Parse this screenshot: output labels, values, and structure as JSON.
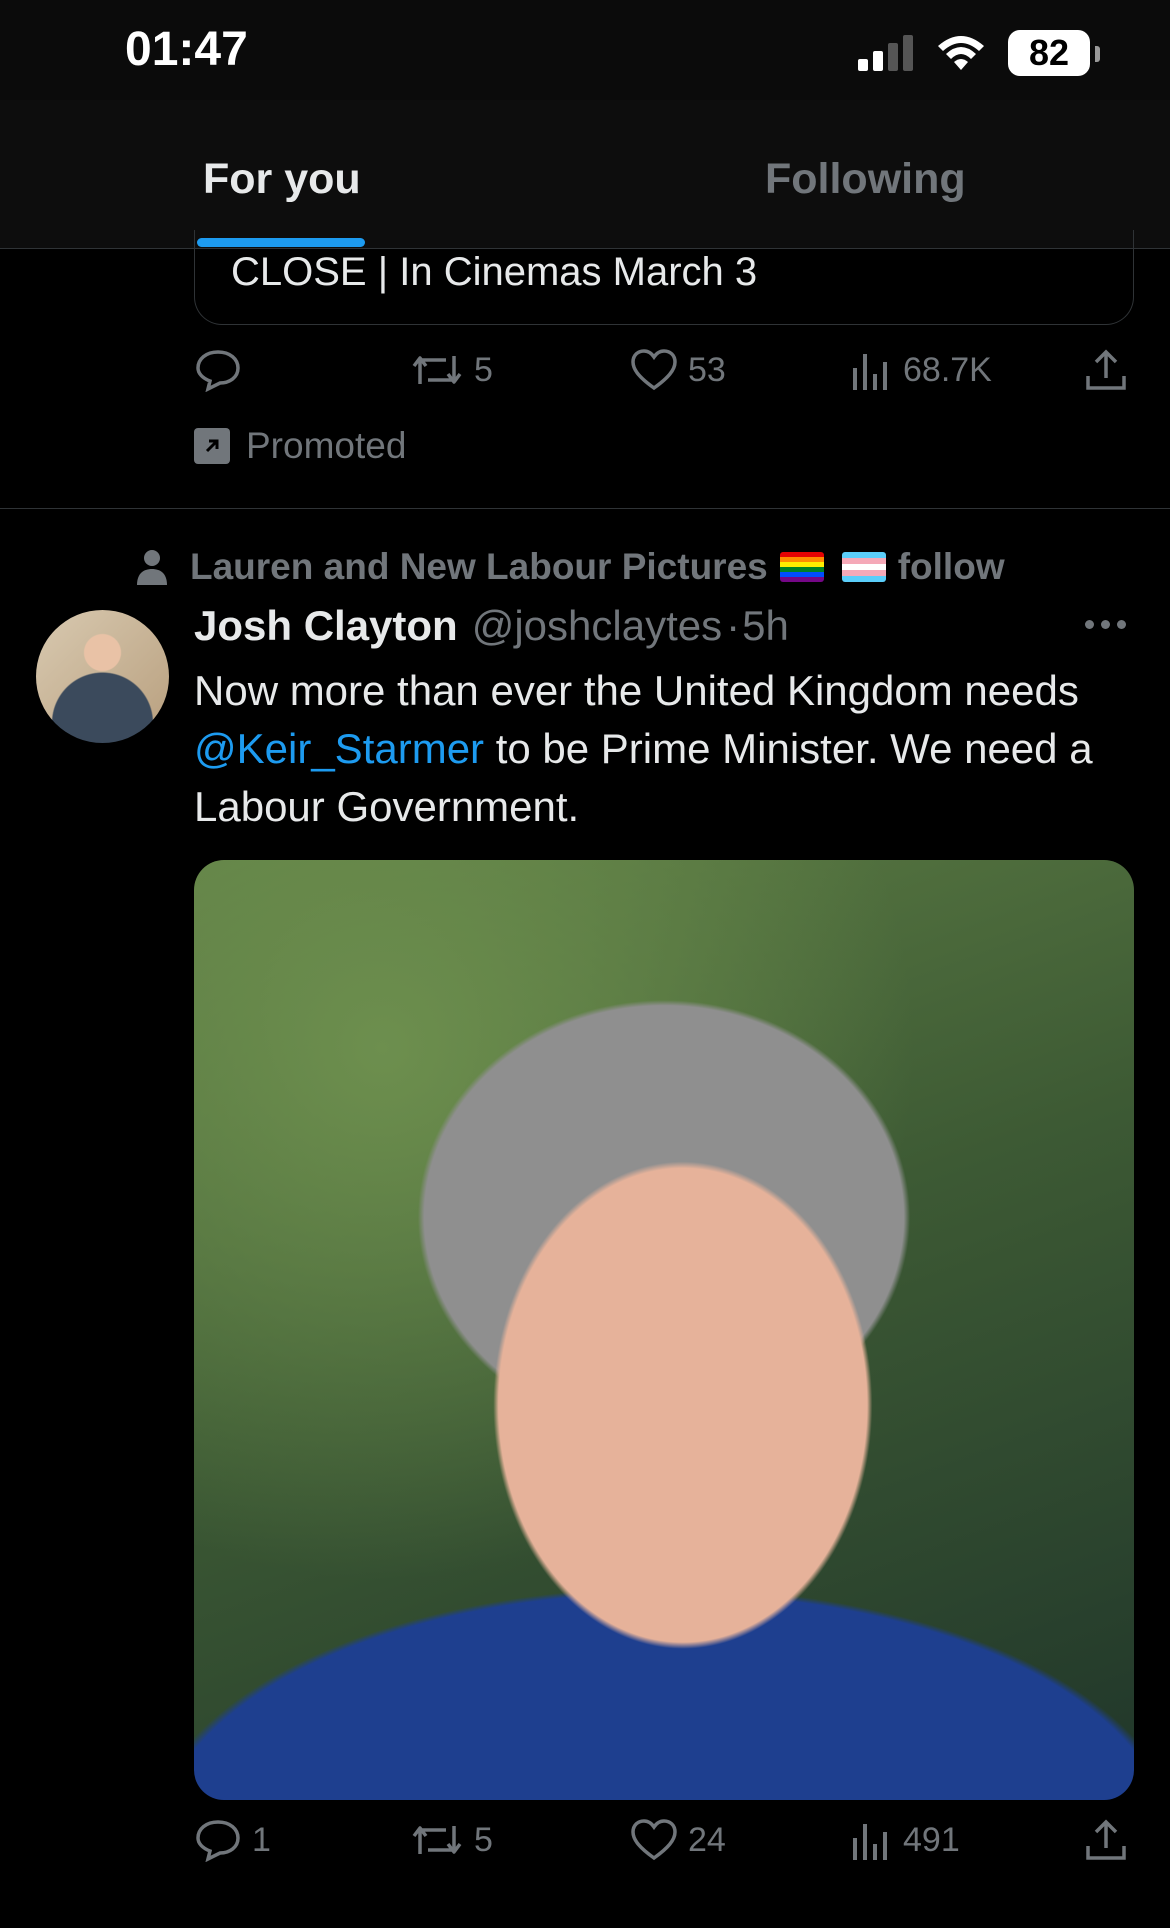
{
  "status_bar": {
    "time": "01:47",
    "battery": "82"
  },
  "tabs": [
    {
      "label": "For you",
      "active": true
    },
    {
      "label": "Following",
      "active": false
    }
  ],
  "promoted_tweet": {
    "card_text": "CLOSE | In Cinemas March 3",
    "replies": "",
    "retweets": "5",
    "likes": "53",
    "views": "68.7K",
    "promoted_label": "Promoted"
  },
  "tweet": {
    "social_context": "Lauren and New Labour Pictures",
    "social_context_suffix": "follow",
    "name": "Josh Clayton",
    "handle": "@joshclaytes",
    "separator": "·",
    "time": "5h",
    "text_before": "Now more than ever the United Kingdom needs ",
    "mention": "@Keir_Starmer",
    "text_after": " to be Prime Minister. We need a Labour Government.",
    "replies": "1",
    "retweets": "5",
    "likes": "24",
    "views": "491"
  },
  "colors": {
    "accent": "#1d9bf0",
    "muted": "#71767b",
    "background": "#000000"
  },
  "icons": [
    "signal-icon",
    "wifi-icon",
    "reply-icon",
    "retweet-icon",
    "like-icon",
    "views-icon",
    "share-icon",
    "promoted-icon",
    "person-icon",
    "more-icon"
  ]
}
